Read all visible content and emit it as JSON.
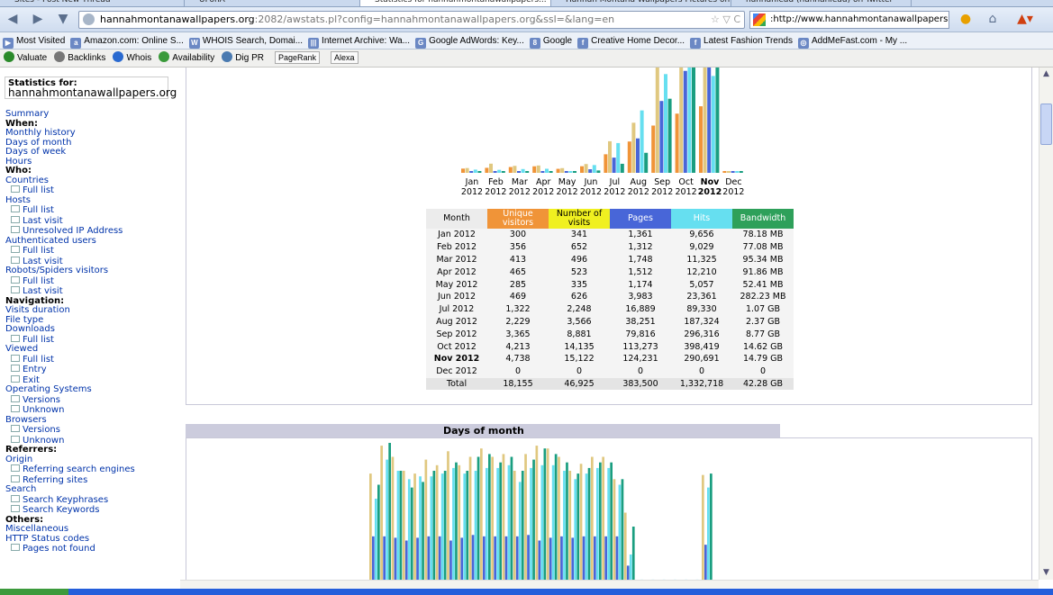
{
  "tabs": [
    {
      "label": "Sites - Post New Thread"
    },
    {
      "label": "UFonA"
    },
    {
      "label": "Statistics for hannahmontanawallpapers..."
    },
    {
      "label": "Hannah Montana Wallpapers Pictures on..."
    },
    {
      "label": "hannahlead (hannahlead) on Twitter"
    }
  ],
  "address": {
    "domain": "hannahmontanawallpapers.org",
    "path": ":2082/awstats.pl?config=hannahmontanawallpapers.org&ssl=&lang=en"
  },
  "search_text": ":http://www.hannahmontanawallpapers.org/",
  "bookmarks": [
    {
      "label": "Most Visited"
    },
    {
      "label": "Amazon.com: Online S..."
    },
    {
      "label": "WHOIS Search, Domai..."
    },
    {
      "label": "Internet Archive: Wa..."
    },
    {
      "label": "Google AdWords: Key..."
    },
    {
      "label": "Google"
    },
    {
      "label": "Creative Home Decor..."
    },
    {
      "label": "Latest Fashion Trends"
    },
    {
      "label": "AddMeFast.com - My ..."
    }
  ],
  "seo_toolbar": [
    {
      "label": "Valuate"
    },
    {
      "label": "Backlinks"
    },
    {
      "label": "Whois"
    },
    {
      "label": "Availability"
    },
    {
      "label": "Dig PR"
    },
    {
      "label": "PageRank"
    },
    {
      "label": "Alexa"
    }
  ],
  "sidebar": {
    "stats_for_label": "Statistics for:",
    "site": "hannahmontanawallpapers.org",
    "items": [
      {
        "type": "link",
        "label": "Summary"
      },
      {
        "type": "head",
        "label": "When:"
      },
      {
        "type": "link",
        "label": "Monthly history"
      },
      {
        "type": "link",
        "label": "Days of month"
      },
      {
        "type": "link",
        "label": "Days of week"
      },
      {
        "type": "link",
        "label": "Hours"
      },
      {
        "type": "head",
        "label": "Who:"
      },
      {
        "type": "link",
        "label": "Countries"
      },
      {
        "type": "sub",
        "label": "Full list"
      },
      {
        "type": "link",
        "label": "Hosts"
      },
      {
        "type": "sub",
        "label": "Full list"
      },
      {
        "type": "sub",
        "label": "Last visit"
      },
      {
        "type": "sub",
        "label": "Unresolved IP Address"
      },
      {
        "type": "link",
        "label": "Authenticated users"
      },
      {
        "type": "sub",
        "label": "Full list"
      },
      {
        "type": "sub",
        "label": "Last visit"
      },
      {
        "type": "link",
        "label": "Robots/Spiders visitors"
      },
      {
        "type": "sub",
        "label": "Full list"
      },
      {
        "type": "sub",
        "label": "Last visit"
      },
      {
        "type": "head",
        "label": "Navigation:"
      },
      {
        "type": "link",
        "label": "Visits duration"
      },
      {
        "type": "link",
        "label": "File type"
      },
      {
        "type": "link",
        "label": "Downloads"
      },
      {
        "type": "sub",
        "label": "Full list"
      },
      {
        "type": "link",
        "label": "Viewed"
      },
      {
        "type": "sub",
        "label": "Full list"
      },
      {
        "type": "sub",
        "label": "Entry"
      },
      {
        "type": "sub",
        "label": "Exit"
      },
      {
        "type": "link",
        "label": "Operating Systems"
      },
      {
        "type": "sub",
        "label": "Versions"
      },
      {
        "type": "sub",
        "label": "Unknown"
      },
      {
        "type": "link",
        "label": "Browsers"
      },
      {
        "type": "sub",
        "label": "Versions"
      },
      {
        "type": "sub",
        "label": "Unknown"
      },
      {
        "type": "head",
        "label": "Referrers:"
      },
      {
        "type": "link",
        "label": "Origin"
      },
      {
        "type": "sub",
        "label": "Referring search engines"
      },
      {
        "type": "sub",
        "label": "Referring sites"
      },
      {
        "type": "link",
        "label": "Search"
      },
      {
        "type": "sub",
        "label": "Search Keyphrases"
      },
      {
        "type": "sub",
        "label": "Search Keywords"
      },
      {
        "type": "head",
        "label": "Others:"
      },
      {
        "type": "link",
        "label": "Miscellaneous"
      },
      {
        "type": "link",
        "label": "HTTP Status codes"
      },
      {
        "type": "sub",
        "label": "Pages not found"
      }
    ]
  },
  "colors": {
    "unique": "#f09438",
    "visits": "#f0f020",
    "pages": "#4866d8",
    "hits": "#66dff0",
    "bandwidth": "#2ea05a",
    "visits_bar": "#e0c880",
    "bandwidth_bar": "#1a9e80"
  },
  "monthly_table": {
    "columns": [
      "Month",
      "Unique visitors",
      "Number of visits",
      "Pages",
      "Hits",
      "Bandwidth"
    ],
    "rows": [
      {
        "month": "Jan 2012",
        "unique": "300",
        "visits": "341",
        "pages": "1,361",
        "hits": "9,656",
        "bandwidth": "78.18 MB"
      },
      {
        "month": "Feb 2012",
        "unique": "356",
        "visits": "652",
        "pages": "1,312",
        "hits": "9,029",
        "bandwidth": "77.08 MB"
      },
      {
        "month": "Mar 2012",
        "unique": "413",
        "visits": "496",
        "pages": "1,748",
        "hits": "11,325",
        "bandwidth": "95.34 MB"
      },
      {
        "month": "Apr 2012",
        "unique": "465",
        "visits": "523",
        "pages": "1,512",
        "hits": "12,210",
        "bandwidth": "91.86 MB"
      },
      {
        "month": "May 2012",
        "unique": "285",
        "visits": "335",
        "pages": "1,174",
        "hits": "5,057",
        "bandwidth": "52.41 MB"
      },
      {
        "month": "Jun 2012",
        "unique": "469",
        "visits": "626",
        "pages": "3,983",
        "hits": "23,361",
        "bandwidth": "282.23 MB"
      },
      {
        "month": "Jul 2012",
        "unique": "1,322",
        "visits": "2,248",
        "pages": "16,889",
        "hits": "89,330",
        "bandwidth": "1.07 GB"
      },
      {
        "month": "Aug 2012",
        "unique": "2,229",
        "visits": "3,566",
        "pages": "38,251",
        "hits": "187,324",
        "bandwidth": "2.37 GB"
      },
      {
        "month": "Sep 2012",
        "unique": "3,365",
        "visits": "8,881",
        "pages": "79,816",
        "hits": "296,316",
        "bandwidth": "8.77 GB"
      },
      {
        "month": "Oct 2012",
        "unique": "4,213",
        "visits": "14,135",
        "pages": "113,273",
        "hits": "398,419",
        "bandwidth": "14.62 GB"
      },
      {
        "month": "Nov 2012",
        "unique": "4,738",
        "visits": "15,122",
        "pages": "124,231",
        "hits": "290,691",
        "bandwidth": "14.79 GB",
        "current": true
      },
      {
        "month": "Dec 2012",
        "unique": "0",
        "visits": "0",
        "pages": "0",
        "hits": "0",
        "bandwidth": "0"
      }
    ],
    "total": {
      "month": "Total",
      "unique": "18,155",
      "visits": "46,925",
      "pages": "383,500",
      "hits": "1,332,718",
      "bandwidth": "42.28 GB"
    }
  },
  "chart_data": [
    {
      "type": "bar",
      "categories": [
        [
          "Jan",
          "2012"
        ],
        [
          "Feb",
          "2012"
        ],
        [
          "Mar",
          "2012"
        ],
        [
          "Apr",
          "2012"
        ],
        [
          "May",
          "2012"
        ],
        [
          "Jun",
          "2012"
        ],
        [
          "Jul",
          "2012"
        ],
        [
          "Aug",
          "2012"
        ],
        [
          "Sep",
          "2012"
        ],
        [
          "Oct",
          "2012"
        ],
        [
          "Nov",
          "2012"
        ],
        [
          "Dec",
          "2012"
        ]
      ],
      "series": [
        {
          "name": "Unique visitors",
          "color": "#f09438",
          "values": [
            300,
            356,
            413,
            465,
            285,
            469,
            1322,
            2229,
            3365,
            4213,
            4738,
            0
          ]
        },
        {
          "name": "Number of visits",
          "color": "#e0c880",
          "values": [
            341,
            652,
            496,
            523,
            335,
            626,
            2248,
            3566,
            8881,
            14135,
            15122,
            0
          ]
        },
        {
          "name": "Pages",
          "color": "#4866d8",
          "values": [
            1361,
            1312,
            1748,
            1512,
            1174,
            3983,
            16889,
            38251,
            79816,
            113273,
            124231,
            0
          ]
        },
        {
          "name": "Hits",
          "color": "#66dff0",
          "values": [
            9656,
            9029,
            11325,
            12210,
            5057,
            23361,
            89330,
            187324,
            296316,
            398419,
            290691,
            0
          ]
        },
        {
          "name": "Bandwidth (GB)",
          "color": "#1a9e80",
          "values": [
            0.078,
            0.077,
            0.095,
            0.092,
            0.052,
            0.282,
            1.07,
            2.37,
            8.77,
            14.62,
            14.79,
            0
          ]
        }
      ]
    },
    {
      "type": "bar",
      "title": "Days of month",
      "series": [
        {
          "name": "Number of visits",
          "color": "#e0c880",
          "values": [
            0.78,
            0.98,
            0.9,
            0.8,
            0.78,
            0.88,
            0.84,
            0.94,
            0.84,
            0.9,
            0.96,
            0.9,
            0.92,
            0.8,
            0.92,
            0.98,
            0.96,
            0.9,
            0.8,
            0.85,
            0.9,
            0.9,
            0.74,
            0.5,
            0,
            0,
            0,
            0,
            0,
            0,
            0.77
          ]
        },
        {
          "name": "Pages",
          "color": "#4866d8",
          "values": [
            0.33,
            0.33,
            0.32,
            0.3,
            0.32,
            0.33,
            0.33,
            0.3,
            0.32,
            0.34,
            0.33,
            0.33,
            0.33,
            0.33,
            0.34,
            0.3,
            0.32,
            0.33,
            0.32,
            0.33,
            0.33,
            0.33,
            0.33,
            0.12,
            0,
            0,
            0,
            0,
            0,
            0,
            0.27
          ]
        },
        {
          "name": "Hits",
          "color": "#66dff0",
          "values": [
            0.6,
            0.88,
            0.8,
            0.74,
            0.76,
            0.76,
            0.78,
            0.82,
            0.78,
            0.8,
            0.82,
            0.82,
            0.84,
            0.72,
            0.82,
            0.84,
            0.84,
            0.8,
            0.74,
            0.78,
            0.82,
            0.82,
            0.7,
            0.2,
            0.02,
            0.02,
            0.02,
            0.02,
            0.02,
            0.02,
            0.68
          ]
        },
        {
          "name": "Bandwidth",
          "color": "#1a9e80",
          "values": [
            0.7,
            1.0,
            0.8,
            0.68,
            0.72,
            0.8,
            0.8,
            0.86,
            0.8,
            0.9,
            0.92,
            0.86,
            0.9,
            0.8,
            0.88,
            0.96,
            0.92,
            0.86,
            0.78,
            0.82,
            0.86,
            0.86,
            0.74,
            0.4,
            0,
            0,
            0,
            0,
            0,
            0,
            0.78
          ]
        }
      ]
    }
  ]
}
